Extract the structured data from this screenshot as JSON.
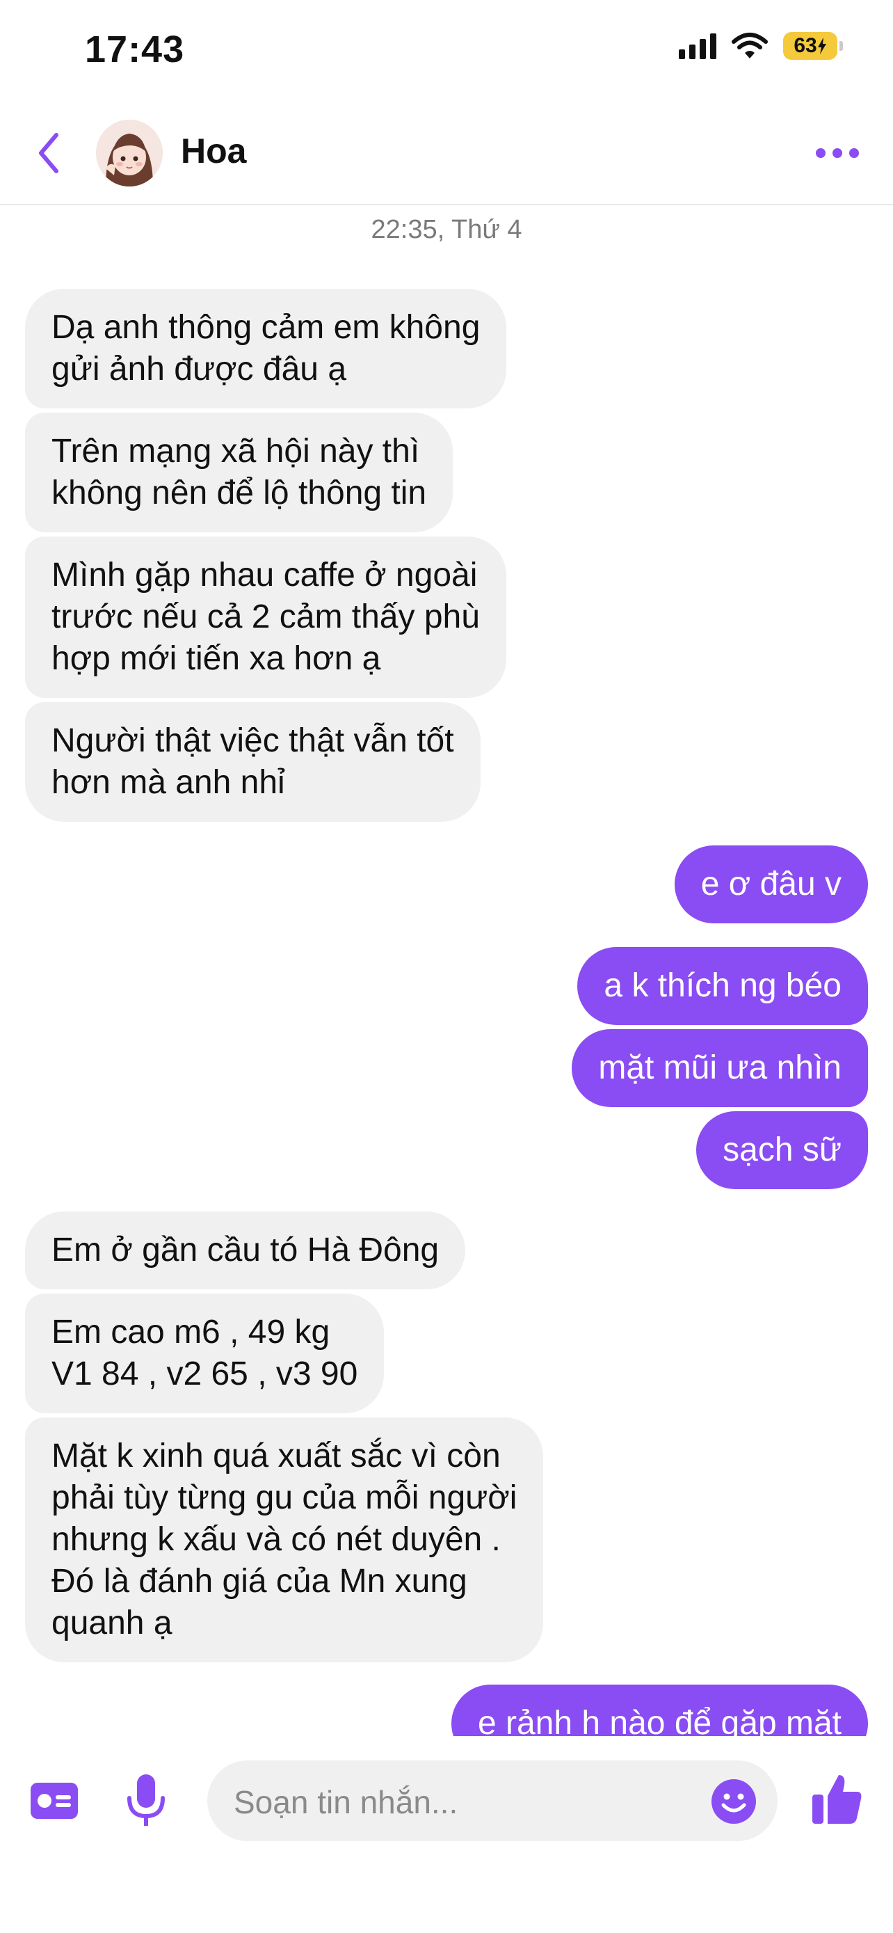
{
  "status_bar": {
    "time": "17:43",
    "battery": "63"
  },
  "header": {
    "name": "Hoa"
  },
  "conversation": {
    "timestamp": "22:35, Thứ 4",
    "messages": [
      {
        "from": "them",
        "text": "Dạ anh thông cảm em không\ngửi ảnh được đâu ạ"
      },
      {
        "from": "them",
        "text": "Trên mạng xã hội này thì\nkhông nên để lộ thông tin"
      },
      {
        "from": "them",
        "text": "Mình gặp nhau caffe ở ngoài\ntrước nếu cả 2 cảm thấy phù\nhợp mới tiến xa hơn ạ"
      },
      {
        "from": "them",
        "text": "Người thật việc thật vẫn tốt\nhơn mà anh nhỉ"
      },
      {
        "from": "me",
        "text": "e ơ đâu v"
      },
      {
        "from": "me",
        "text": "a k thích ng béo"
      },
      {
        "from": "me",
        "text": "mặt mũi ưa nhìn"
      },
      {
        "from": "me",
        "text": "sạch sữ"
      },
      {
        "from": "them",
        "text": "Em ở gần cầu tó Hà Đông"
      },
      {
        "from": "them",
        "text": "Em cao m6 , 49 kg\nV1 84 , v2 65 , v3 90"
      },
      {
        "from": "them",
        "text": "Mặt k xinh quá xuất sắc vì còn\nphải tùy từng gu của mỗi người\nnhưng k xấu và có nét duyên .\nĐó là đánh giá của Mn xung\nquanh ạ"
      },
      {
        "from": "me",
        "text": "e rảnh h nào để gặp mặt"
      }
    ]
  },
  "composer": {
    "placeholder": "Soạn tin nhắn..."
  },
  "colors": {
    "accent": "#8a4cf3",
    "incoming_bubble": "#f0f0f0"
  },
  "icons": [
    "back-chevron",
    "avatar",
    "more-dots",
    "contact-card",
    "microphone",
    "emoji",
    "thumbs-up",
    "signal",
    "wifi",
    "battery"
  ]
}
